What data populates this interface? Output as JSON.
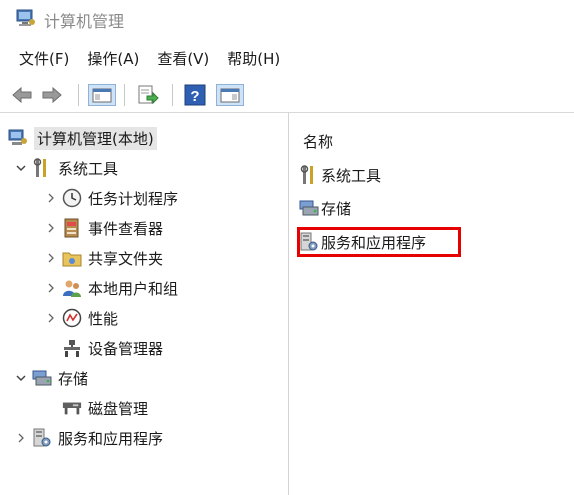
{
  "window": {
    "title": "计算机管理"
  },
  "menu": [
    "文件(F)",
    "操作(A)",
    "查看(V)",
    "帮助(H)"
  ],
  "toolbar": [
    {
      "icon": "back-arrow-icon"
    },
    {
      "icon": "forward-arrow-icon"
    },
    {
      "icon": "show-hide-console-tree-icon"
    },
    {
      "icon": "export-list-icon"
    },
    {
      "icon": "help-icon"
    },
    {
      "icon": "show-hide-action-pane-icon"
    }
  ],
  "tree": [
    {
      "label": "计算机管理(本地)",
      "icon": "computer-management-icon",
      "expander": "none",
      "selected": true
    },
    {
      "label": "系统工具",
      "icon": "system-tools-icon",
      "expander": "expanded"
    },
    {
      "label": "任务计划程序",
      "icon": "clock-icon",
      "expander": "collapsed"
    },
    {
      "label": "事件查看器",
      "icon": "event-viewer-icon",
      "expander": "collapsed"
    },
    {
      "label": "共享文件夹",
      "icon": "shared-folder-icon",
      "expander": "collapsed"
    },
    {
      "label": "本地用户和组",
      "icon": "users-icon",
      "expander": "collapsed"
    },
    {
      "label": "性能",
      "icon": "performance-icon",
      "expander": "collapsed"
    },
    {
      "label": "设备管理器",
      "icon": "device-manager-icon",
      "expander": "none"
    },
    {
      "label": "存储",
      "icon": "storage-icon",
      "expander": "expanded"
    },
    {
      "label": "磁盘管理",
      "icon": "disk-management-icon",
      "expander": "none"
    },
    {
      "label": "服务和应用程序",
      "icon": "services-apps-icon",
      "expander": "collapsed"
    }
  ],
  "list": {
    "header": "名称",
    "items": [
      {
        "label": "系统工具",
        "icon": "system-tools-icon"
      },
      {
        "label": "存储",
        "icon": "storage-icon"
      },
      {
        "label": "服务和应用程序",
        "icon": "services-apps-icon",
        "highlighted": true
      }
    ]
  },
  "colors": {
    "highlight": "#e60000",
    "selection": "#e5e5e5"
  }
}
